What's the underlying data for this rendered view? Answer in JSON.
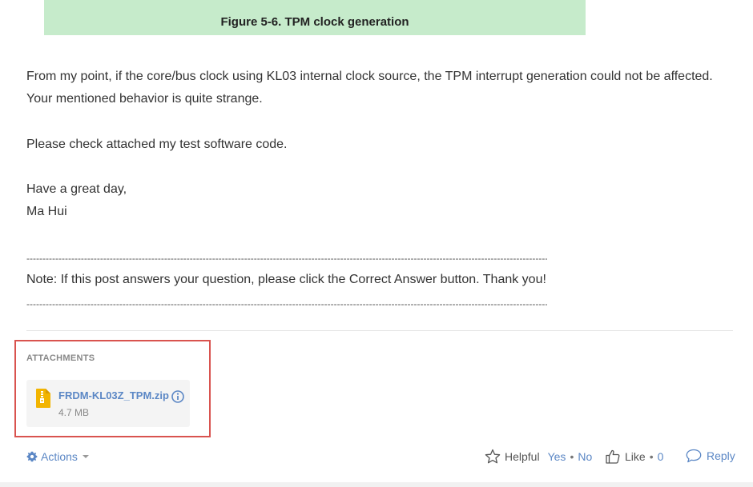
{
  "figure": {
    "caption": "Figure 5-6. TPM clock generation"
  },
  "post": {
    "paragraph1": "From my point, if the core/bus clock using KL03 internal clock source, the TPM interrupt generation could not be affected. Your mentioned behavior is quite strange.",
    "paragraph2": "Please check attached my test software code.",
    "signoff_line1": "Have a great day,",
    "signoff_line2": "Ma Hui",
    "separator": "--------------------------------------------------------------------------------------------------------------------------------------------------------------------",
    "note": "Note: If this post answers your question, please click the Correct Answer button. Thank you!"
  },
  "attachments": {
    "title": "ATTACHMENTS",
    "files": [
      {
        "name": "FRDM-KL03Z_TPM.zip",
        "size": "4.7 MB",
        "icon": "zip-file-icon"
      }
    ]
  },
  "footer": {
    "actions_label": "Actions",
    "helpful_label": "Helpful",
    "yes_label": "Yes",
    "dot": "•",
    "no_label": "No",
    "like_label": "Like",
    "like_count": "0",
    "reply_label": "Reply"
  },
  "colors": {
    "link": "#5b87c5",
    "caption_bg": "#c6ebcb",
    "highlight_border": "#d9534f",
    "zip_icon": "#f2b400"
  }
}
